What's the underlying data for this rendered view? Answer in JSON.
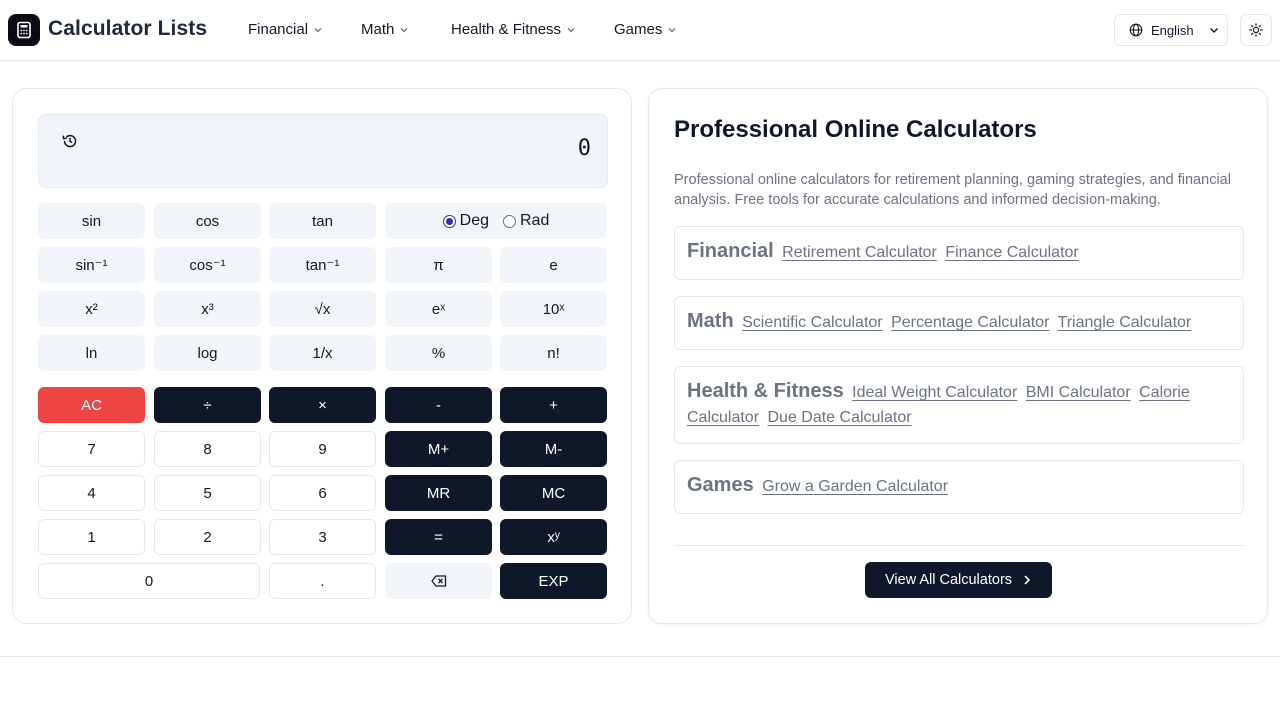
{
  "header": {
    "brand": "Calculator Lists",
    "nav": [
      {
        "label": "Financial"
      },
      {
        "label": "Math"
      },
      {
        "label": "Health & Fitness"
      },
      {
        "label": "Games"
      }
    ],
    "language": "English"
  },
  "calculator": {
    "display_value": "0",
    "angle_mode": {
      "deg_label": "Deg",
      "rad_label": "Rad",
      "selected": "Deg"
    },
    "keys": {
      "sin": "sin",
      "cos": "cos",
      "tan": "tan",
      "asin": "sin⁻¹",
      "acos": "cos⁻¹",
      "atan": "tan⁻¹",
      "pi": "π",
      "e": "e",
      "square": "x²",
      "cube": "x³",
      "sqrt": "√x",
      "exp": "eˣ",
      "ten_pow": "10ˣ",
      "ln": "ln",
      "log": "log",
      "reciprocal": "1/x",
      "percent": "%",
      "factorial": "n!",
      "clear": "AC",
      "divide": "÷",
      "multiply": "×",
      "minus": "-",
      "plus": "+",
      "seven": "7",
      "eight": "8",
      "nine": "9",
      "m_plus": "M+",
      "m_minus": "M-",
      "four": "4",
      "five": "5",
      "six": "6",
      "mr": "MR",
      "mc": "MC",
      "one": "1",
      "two": "2",
      "three": "3",
      "equals": "=",
      "power": "xʸ",
      "zero": "0",
      "decimal": ".",
      "exp_key": "EXP"
    }
  },
  "info": {
    "title": "Professional Online Calculators",
    "description": "Professional online calculators for retirement planning, gaming strategies, and financial analysis. Free tools for accurate calculations and informed decision-making.",
    "categories": [
      {
        "name": "Financial",
        "links": [
          "Retirement Calculator",
          "Finance Calculator"
        ]
      },
      {
        "name": "Math",
        "links": [
          "Scientific Calculator",
          "Percentage Calculator",
          "Triangle Calculator"
        ]
      },
      {
        "name": "Health & Fitness",
        "links": [
          "Ideal Weight Calculator",
          "BMI Calculator",
          "Calorie Calculator",
          "Due Date Calculator"
        ]
      },
      {
        "name": "Games",
        "links": [
          "Grow a Garden Calculator"
        ]
      }
    ],
    "view_all_label": "View All Calculators"
  },
  "colors": {
    "dark_key": "#0f172a",
    "clear_key": "#ef4444",
    "light_key": "#f1f5f9",
    "radio_selected": "#3730a3"
  }
}
